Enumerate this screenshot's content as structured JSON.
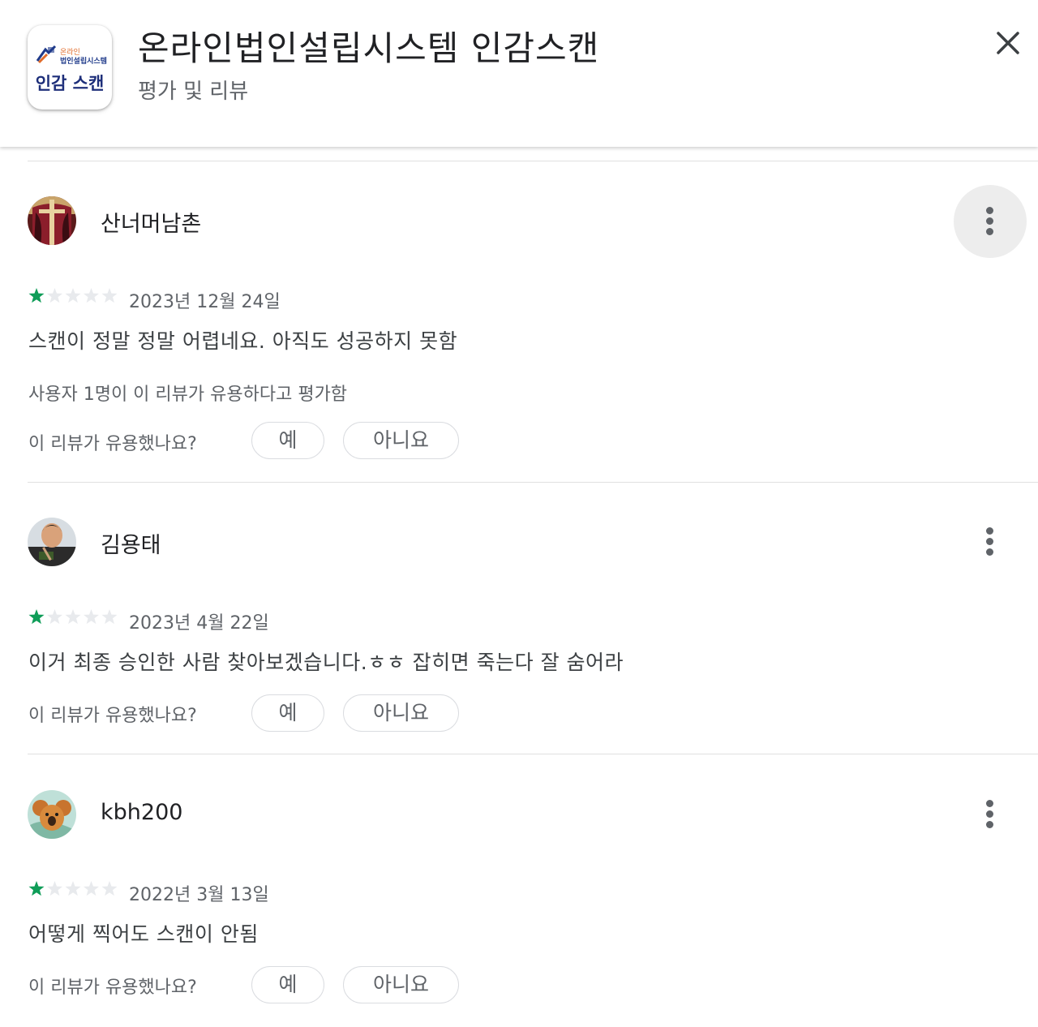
{
  "app": {
    "title": "온라인법인설립시스템 인감스캔",
    "subtitle": "평가 및 리뷰",
    "icon_text_top_line1": "온라인",
    "icon_text_top_line2": "법인설립시스템",
    "icon_text_big": "인감 스캔",
    "close_icon": "close-icon"
  },
  "colors": {
    "star_filled": "#0f9d58",
    "star_empty": "#e8eaed",
    "icon_navy": "#1e2f7a",
    "icon_orange": "#e06b2a"
  },
  "reviews": [
    {
      "author": "산너머남촌",
      "rating": 1,
      "max_rating": 5,
      "date": "2023년 12월 24일",
      "text": "스캔이 정말 정말 어렵네요. 아직도 성공하지 못함",
      "helpful_count_text": "사용자 1명이 이 리뷰가 유용하다고 평가함",
      "helpful_question": "이 리뷰가 유용했나요?",
      "yes_label": "예",
      "no_label": "아니요",
      "more_icon": "more-vert-icon"
    },
    {
      "author": "김용태",
      "rating": 1,
      "max_rating": 5,
      "date": "2023년 4월 22일",
      "text": "이거 최종 승인한 사람 찾아보겠습니다.ㅎㅎ 잡히면 죽는다 잘 숨어라",
      "helpful_question": "이 리뷰가 유용했나요?",
      "yes_label": "예",
      "no_label": "아니요",
      "more_icon": "more-vert-icon"
    },
    {
      "author": "kbh200",
      "rating": 1,
      "max_rating": 5,
      "date": "2022년 3월 13일",
      "text": "어떻게 찍어도 스캔이 안됨",
      "helpful_question": "이 리뷰가 유용했나요?",
      "yes_label": "예",
      "no_label": "아니요",
      "more_icon": "more-vert-icon"
    }
  ]
}
